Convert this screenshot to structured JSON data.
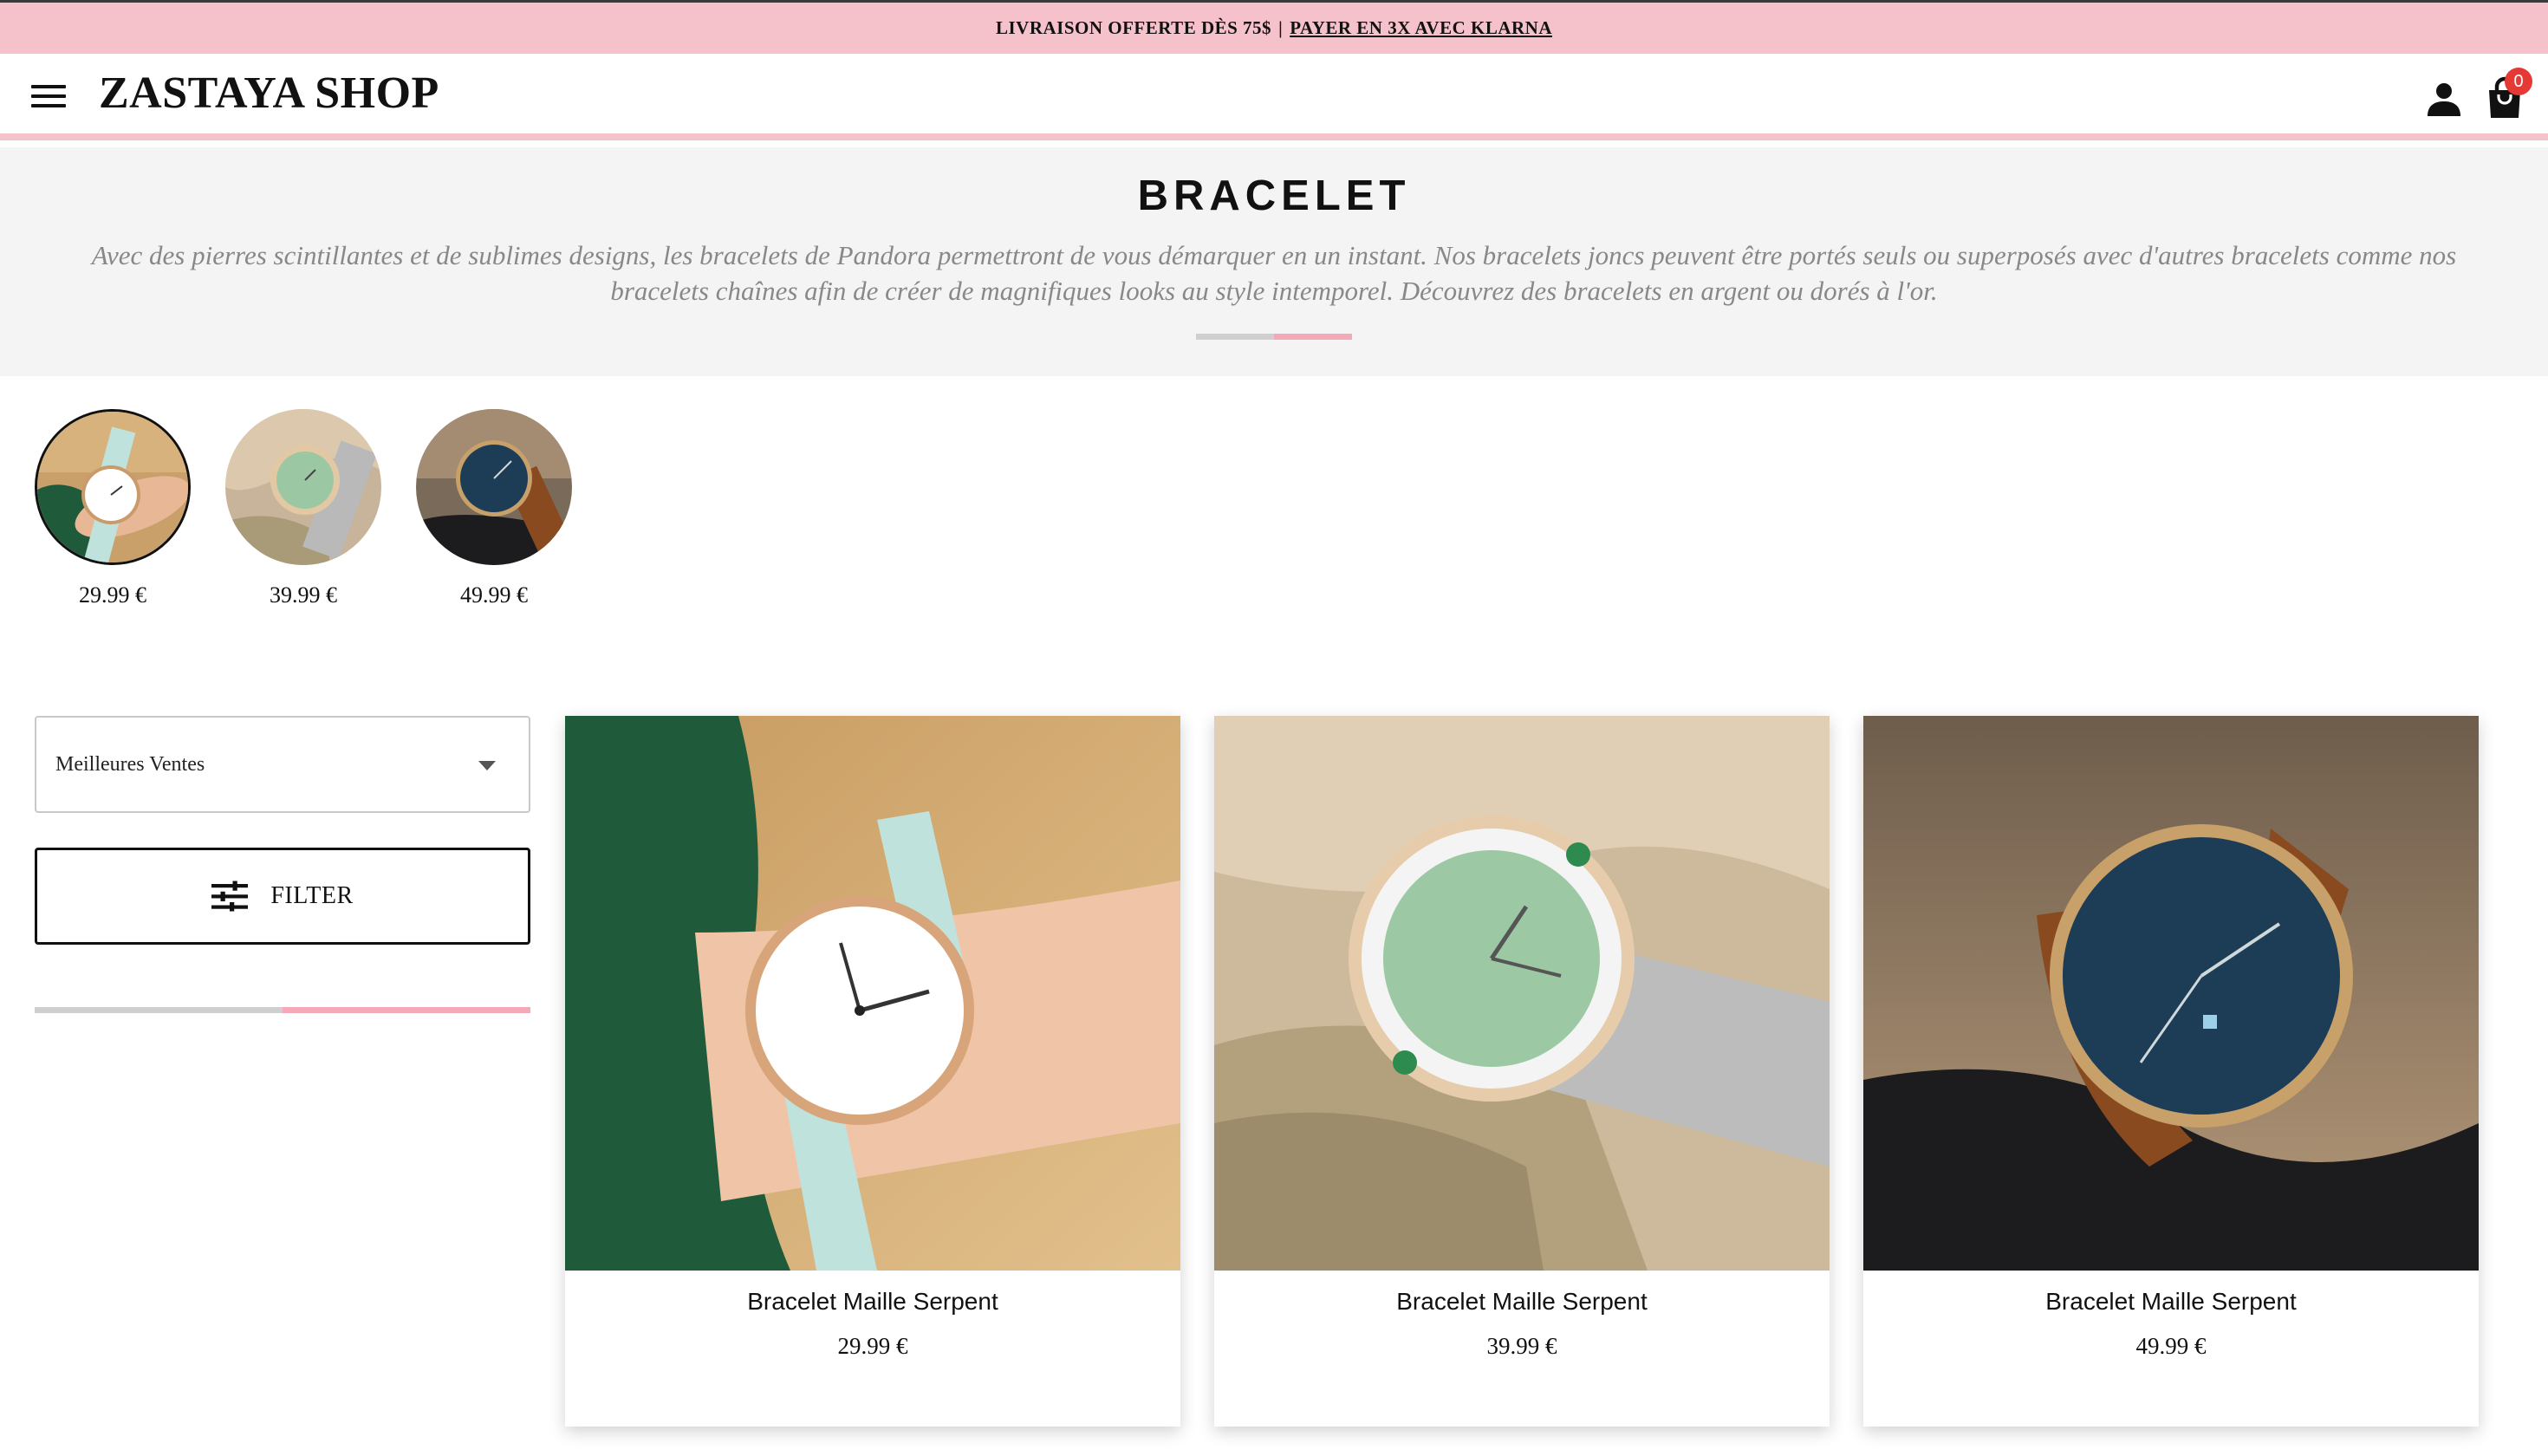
{
  "announcement": {
    "text": "LIVRAISON OFFERTE DÈS 75$",
    "separator": "|",
    "link": "PAYER EN 3X AVEC KLARNA"
  },
  "header": {
    "logo": "ZASTAYA SHOP",
    "cart_count": "0",
    "icons": [
      "menu-icon",
      "user-icon",
      "shopping-bag-icon"
    ]
  },
  "banner": {
    "title": "BRACELET",
    "description": "Avec des pierres scintillantes et de sublimes designs, les bracelets de Pandora permettront de vous démarquer en un instant. Nos bracelets joncs peuvent être portés seuls ou superposés avec d'autres bracelets comme nos bracelets chaînes afin de créer de magnifiques looks au style intemporel. Découvrez des bracelets en argent ou dorés à l'or."
  },
  "thumbnails": [
    {
      "price": "29.99 €",
      "selected": true
    },
    {
      "price": "39.99 €",
      "selected": false
    },
    {
      "price": "49.99 €",
      "selected": false
    }
  ],
  "sidebar": {
    "sort_value": "Meilleures Ventes",
    "filter_label": "FILTER"
  },
  "products": [
    {
      "name": "Bracelet Maille Serpent",
      "price": "29.99 €"
    },
    {
      "name": "Bracelet Maille Serpent",
      "price": "39.99 €"
    },
    {
      "name": "Bracelet Maille Serpent",
      "price": "49.99 €"
    }
  ],
  "colors": {
    "accent_pink": "#f5c2cc",
    "badge_red": "#e53935"
  }
}
